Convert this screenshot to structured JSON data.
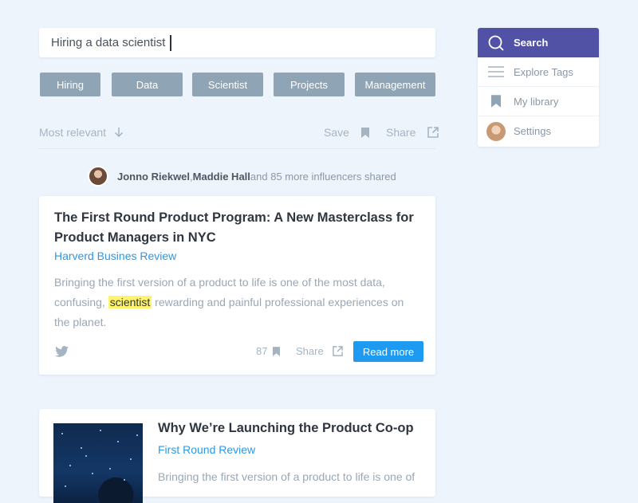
{
  "search": {
    "value": "Hiring a data scientist"
  },
  "tags": [
    "Hiring",
    "Data",
    "Scientist",
    "Projects",
    "Management"
  ],
  "toolbar": {
    "sort_label": "Most relevant",
    "save_label": "Save",
    "share_label": "Share"
  },
  "shared": {
    "user1": "Jonno Riekwel",
    "separator": ", ",
    "user2": "Maddie Hall",
    "rest": " and 85 more influencers shared"
  },
  "card1": {
    "title": "The First Round Product Program: A New Masterclass for Product Managers in NYC",
    "source": "Harverd Busines Review",
    "desc_before": "Bringing the first version of a product to life is one of the most data, confusing, ",
    "desc_highlight": "scientist",
    "desc_after": " rewarding and painful professional experiences on the planet.",
    "save_count": "87",
    "share_label": "Share",
    "read_more": "Read more"
  },
  "card2": {
    "title": "Why We’re Launching the Product Co-op",
    "source": "First Round Review",
    "desc": "Bringing the first version of a product to life is one of"
  },
  "sidebar": {
    "items": [
      {
        "label": "Search",
        "icon": "search-icon"
      },
      {
        "label": "Explore Tags",
        "icon": "menu-icon"
      },
      {
        "label": "My library",
        "icon": "bookmark-icon"
      },
      {
        "label": "Settings",
        "icon": "avatar"
      }
    ]
  },
  "colors": {
    "accent": "#5152a6",
    "primary": "#1e9af0",
    "chip": "#8fa5b6",
    "highlight": "#fff36b",
    "background": "#eef4fc"
  }
}
